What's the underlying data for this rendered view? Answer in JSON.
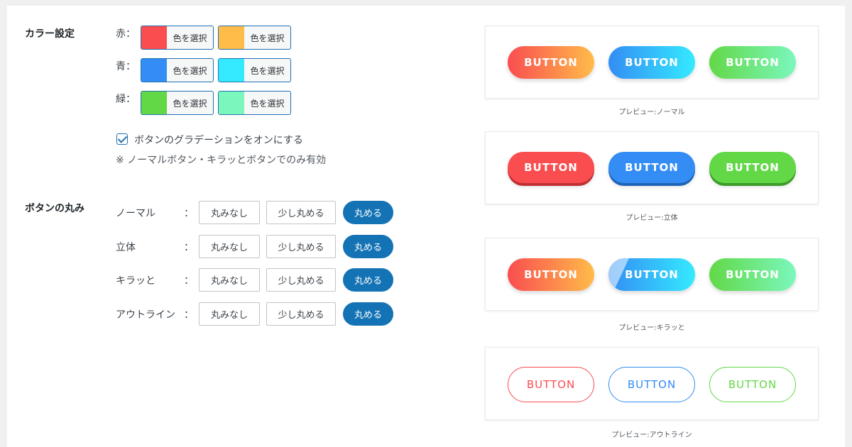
{
  "color_settings": {
    "title": "カラー設定",
    "rows": [
      {
        "label": "赤：",
        "pickers": [
          {
            "color": "#f94d50",
            "label": "色を選択"
          },
          {
            "color": "#ffbc49",
            "label": "色を選択"
          }
        ]
      },
      {
        "label": "青：",
        "pickers": [
          {
            "color": "#338df4",
            "label": "色を選択"
          },
          {
            "color": "#35eaff",
            "label": "色を選択"
          }
        ]
      },
      {
        "label": "緑：",
        "pickers": [
          {
            "color": "#62d847",
            "label": "色を選択"
          },
          {
            "color": "#7bf7bd",
            "label": "色を選択"
          }
        ]
      }
    ],
    "gradient_checkbox": {
      "label": "ボタンのグラデーションをオンにする",
      "checked": true
    },
    "note": "※ ノーマルボタン・キラッとボタンでのみ有効"
  },
  "roundness": {
    "title": "ボタンの丸み",
    "rows": [
      {
        "label": "ノーマル",
        "colon": "：",
        "options": [
          "丸みなし",
          "少し丸める",
          "丸める"
        ],
        "selected": "丸める"
      },
      {
        "label": "立体",
        "colon": "：",
        "options": [
          "丸みなし",
          "少し丸める",
          "丸める"
        ],
        "selected": "丸める"
      },
      {
        "label": "キラッと",
        "colon": "：",
        "options": [
          "丸みなし",
          "少し丸める",
          "丸める"
        ],
        "selected": "丸める"
      },
      {
        "label": "アウトライン",
        "colon": "：",
        "options": [
          "丸みなし",
          "少し丸める",
          "丸める"
        ],
        "selected": "丸める"
      }
    ]
  },
  "previews": [
    {
      "caption": "プレビュー:ノーマル",
      "buttons": [
        "BUTTON",
        "BUTTON",
        "BUTTON"
      ]
    },
    {
      "caption": "プレビュー:立体",
      "buttons": [
        "BUTTON",
        "BUTTON",
        "BUTTON"
      ]
    },
    {
      "caption": "プレビュー:キラッと",
      "buttons": [
        "BUTTON",
        "BUTTON",
        "BUTTON"
      ]
    },
    {
      "caption": "プレビュー:アウトライン",
      "buttons": [
        "BUTTON",
        "BUTTON",
        "BUTTON"
      ]
    }
  ]
}
